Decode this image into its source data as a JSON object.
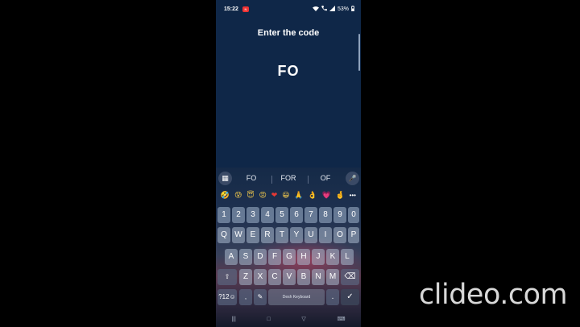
{
  "status_bar": {
    "time": "15:22",
    "notification": "N",
    "battery": "53%",
    "icons": [
      "wifi-icon",
      "call-icon",
      "signal-icon",
      "battery-icon"
    ]
  },
  "screen": {
    "title": "Enter the code",
    "code": "FO"
  },
  "keyboard": {
    "suggestions": [
      "FO",
      "FOR",
      "OF"
    ],
    "emojis": [
      "🤣",
      "😰",
      "😇",
      "😡",
      "❤",
      "😀",
      "🙏",
      "👌",
      "💗",
      "🤞"
    ],
    "more_emoji": "•••",
    "number_row": [
      "1",
      "2",
      "3",
      "4",
      "5",
      "6",
      "7",
      "8",
      "9",
      "0"
    ],
    "row1": [
      "Q",
      "W",
      "E",
      "R",
      "T",
      "Y",
      "U",
      "I",
      "O",
      "P"
    ],
    "row2": [
      "A",
      "S",
      "D",
      "F",
      "G",
      "H",
      "J",
      "K",
      "L"
    ],
    "row3": [
      "Z",
      "X",
      "C",
      "V",
      "B",
      "N",
      "M"
    ],
    "symbols_label": "?12☺",
    "comma_label": ",",
    "space_label": "Desh Keyboard",
    "period_label": ".",
    "enter_label": "✓",
    "shift_label": "⇧",
    "backspace_label": "⌫",
    "apps_label": "▦",
    "mic_label": "🎤",
    "voice_label": "✎"
  },
  "navbar": {
    "recents": "|||",
    "home": "□",
    "back": "▽",
    "keyboard": "⌨"
  },
  "watermark": "clideo.com"
}
